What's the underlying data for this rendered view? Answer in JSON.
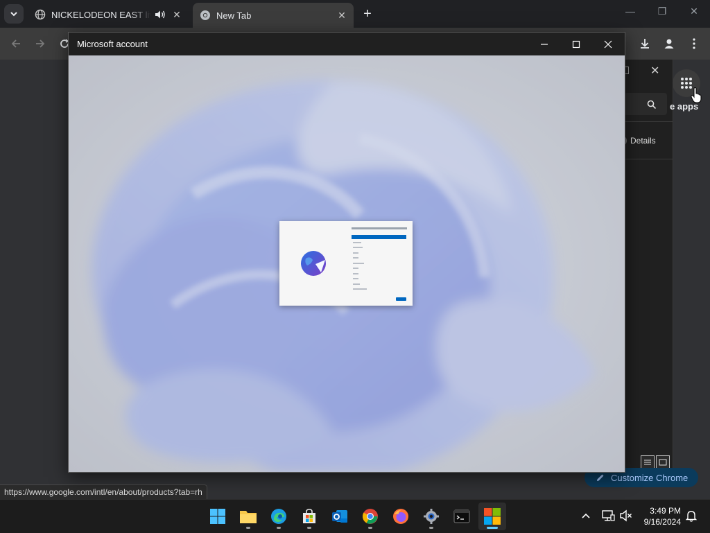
{
  "browser": {
    "tabs": [
      {
        "title": "NICKELODEON EAST live stream",
        "active": false,
        "audible": true
      },
      {
        "title": "New Tab",
        "active": true,
        "audible": false
      }
    ],
    "new_tab_symbol": "+",
    "window_controls": {
      "minimize": "—",
      "maximize": "❐",
      "close": "✕"
    }
  },
  "toolbar": {
    "icons": [
      "back-icon",
      "forward-icon",
      "reload-icon",
      "download-icon",
      "profile-icon",
      "menu-icon"
    ]
  },
  "newtab": {
    "apps_label": "e apps",
    "customize_label": "Customize Chrome"
  },
  "store_window": {
    "details_label": "Details",
    "close_symbol": "✕"
  },
  "status_bar": {
    "url": "https://www.google.com/intl/en/about/products?tab=rh"
  },
  "ms_dialog": {
    "title": "Microsoft account",
    "controls": {
      "minimize": "—",
      "maximize": "☐",
      "close": "✕"
    }
  },
  "taskbar": {
    "apps": [
      {
        "name": "start",
        "active": false
      },
      {
        "name": "file-explorer",
        "active": false
      },
      {
        "name": "edge",
        "active": false
      },
      {
        "name": "microsoft-store",
        "active": false
      },
      {
        "name": "outlook",
        "active": false
      },
      {
        "name": "chrome",
        "active": false
      },
      {
        "name": "firefox",
        "active": false
      },
      {
        "name": "settings",
        "active": false
      },
      {
        "name": "terminal",
        "active": false
      },
      {
        "name": "microsoft-account",
        "active": true
      }
    ],
    "time": "3:49 PM",
    "date": "9/16/2024"
  },
  "colors": {
    "chrome_dark": "#202124",
    "accent_blue": "#0067c0",
    "taskbar_indicator": "#60cdff"
  }
}
